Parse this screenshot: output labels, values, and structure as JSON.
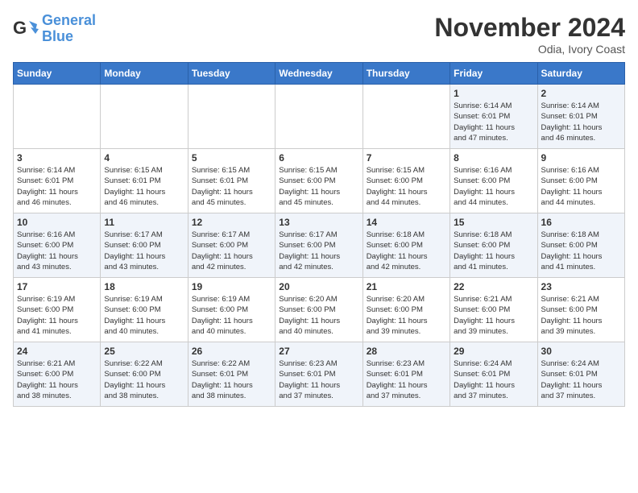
{
  "header": {
    "logo_line1": "General",
    "logo_line2": "Blue",
    "month_title": "November 2024",
    "location": "Odia, Ivory Coast"
  },
  "days_of_week": [
    "Sunday",
    "Monday",
    "Tuesday",
    "Wednesday",
    "Thursday",
    "Friday",
    "Saturday"
  ],
  "weeks": [
    [
      {
        "day": "",
        "info": ""
      },
      {
        "day": "",
        "info": ""
      },
      {
        "day": "",
        "info": ""
      },
      {
        "day": "",
        "info": ""
      },
      {
        "day": "",
        "info": ""
      },
      {
        "day": "1",
        "info": "Sunrise: 6:14 AM\nSunset: 6:01 PM\nDaylight: 11 hours\nand 47 minutes."
      },
      {
        "day": "2",
        "info": "Sunrise: 6:14 AM\nSunset: 6:01 PM\nDaylight: 11 hours\nand 46 minutes."
      }
    ],
    [
      {
        "day": "3",
        "info": "Sunrise: 6:14 AM\nSunset: 6:01 PM\nDaylight: 11 hours\nand 46 minutes."
      },
      {
        "day": "4",
        "info": "Sunrise: 6:15 AM\nSunset: 6:01 PM\nDaylight: 11 hours\nand 46 minutes."
      },
      {
        "day": "5",
        "info": "Sunrise: 6:15 AM\nSunset: 6:01 PM\nDaylight: 11 hours\nand 45 minutes."
      },
      {
        "day": "6",
        "info": "Sunrise: 6:15 AM\nSunset: 6:00 PM\nDaylight: 11 hours\nand 45 minutes."
      },
      {
        "day": "7",
        "info": "Sunrise: 6:15 AM\nSunset: 6:00 PM\nDaylight: 11 hours\nand 44 minutes."
      },
      {
        "day": "8",
        "info": "Sunrise: 6:16 AM\nSunset: 6:00 PM\nDaylight: 11 hours\nand 44 minutes."
      },
      {
        "day": "9",
        "info": "Sunrise: 6:16 AM\nSunset: 6:00 PM\nDaylight: 11 hours\nand 44 minutes."
      }
    ],
    [
      {
        "day": "10",
        "info": "Sunrise: 6:16 AM\nSunset: 6:00 PM\nDaylight: 11 hours\nand 43 minutes."
      },
      {
        "day": "11",
        "info": "Sunrise: 6:17 AM\nSunset: 6:00 PM\nDaylight: 11 hours\nand 43 minutes."
      },
      {
        "day": "12",
        "info": "Sunrise: 6:17 AM\nSunset: 6:00 PM\nDaylight: 11 hours\nand 42 minutes."
      },
      {
        "day": "13",
        "info": "Sunrise: 6:17 AM\nSunset: 6:00 PM\nDaylight: 11 hours\nand 42 minutes."
      },
      {
        "day": "14",
        "info": "Sunrise: 6:18 AM\nSunset: 6:00 PM\nDaylight: 11 hours\nand 42 minutes."
      },
      {
        "day": "15",
        "info": "Sunrise: 6:18 AM\nSunset: 6:00 PM\nDaylight: 11 hours\nand 41 minutes."
      },
      {
        "day": "16",
        "info": "Sunrise: 6:18 AM\nSunset: 6:00 PM\nDaylight: 11 hours\nand 41 minutes."
      }
    ],
    [
      {
        "day": "17",
        "info": "Sunrise: 6:19 AM\nSunset: 6:00 PM\nDaylight: 11 hours\nand 41 minutes."
      },
      {
        "day": "18",
        "info": "Sunrise: 6:19 AM\nSunset: 6:00 PM\nDaylight: 11 hours\nand 40 minutes."
      },
      {
        "day": "19",
        "info": "Sunrise: 6:19 AM\nSunset: 6:00 PM\nDaylight: 11 hours\nand 40 minutes."
      },
      {
        "day": "20",
        "info": "Sunrise: 6:20 AM\nSunset: 6:00 PM\nDaylight: 11 hours\nand 40 minutes."
      },
      {
        "day": "21",
        "info": "Sunrise: 6:20 AM\nSunset: 6:00 PM\nDaylight: 11 hours\nand 39 minutes."
      },
      {
        "day": "22",
        "info": "Sunrise: 6:21 AM\nSunset: 6:00 PM\nDaylight: 11 hours\nand 39 minutes."
      },
      {
        "day": "23",
        "info": "Sunrise: 6:21 AM\nSunset: 6:00 PM\nDaylight: 11 hours\nand 39 minutes."
      }
    ],
    [
      {
        "day": "24",
        "info": "Sunrise: 6:21 AM\nSunset: 6:00 PM\nDaylight: 11 hours\nand 38 minutes."
      },
      {
        "day": "25",
        "info": "Sunrise: 6:22 AM\nSunset: 6:00 PM\nDaylight: 11 hours\nand 38 minutes."
      },
      {
        "day": "26",
        "info": "Sunrise: 6:22 AM\nSunset: 6:01 PM\nDaylight: 11 hours\nand 38 minutes."
      },
      {
        "day": "27",
        "info": "Sunrise: 6:23 AM\nSunset: 6:01 PM\nDaylight: 11 hours\nand 37 minutes."
      },
      {
        "day": "28",
        "info": "Sunrise: 6:23 AM\nSunset: 6:01 PM\nDaylight: 11 hours\nand 37 minutes."
      },
      {
        "day": "29",
        "info": "Sunrise: 6:24 AM\nSunset: 6:01 PM\nDaylight: 11 hours\nand 37 minutes."
      },
      {
        "day": "30",
        "info": "Sunrise: 6:24 AM\nSunset: 6:01 PM\nDaylight: 11 hours\nand 37 minutes."
      }
    ]
  ]
}
